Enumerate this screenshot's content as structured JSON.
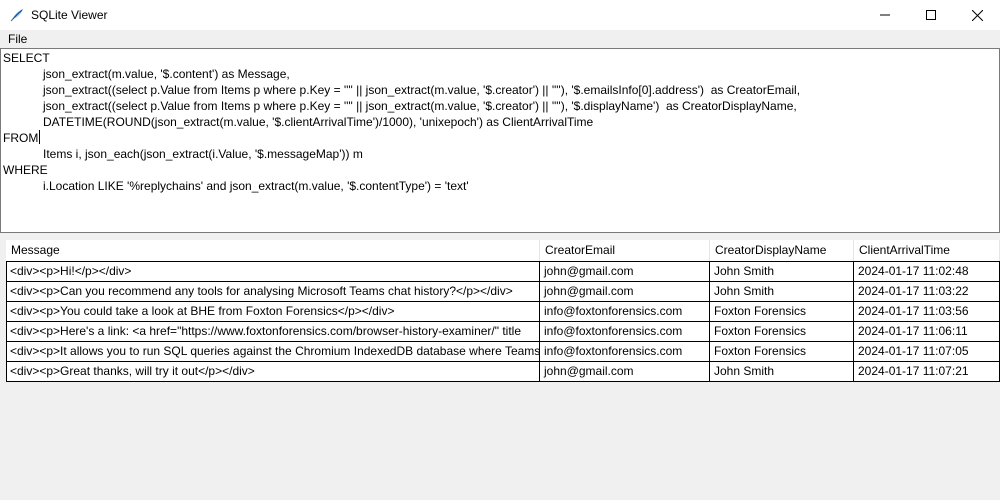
{
  "window": {
    "title": "SQLite Viewer",
    "icon": "sqlite-feather-icon"
  },
  "menu": {
    "items": [
      "File"
    ]
  },
  "editor": {
    "lines": [
      "SELECT",
      "            json_extract(m.value, '$.content') as Message,",
      "            json_extract((select p.Value from Items p where p.Key = '\"' || json_extract(m.value, '$.creator') || '\"'), '$.emailsInfo[0].address')  as CreatorEmail,",
      "            json_extract((select p.Value from Items p where p.Key = '\"' || json_extract(m.value, '$.creator') || '\"'), '$.displayName')  as CreatorDisplayName,",
      "            DATETIME(ROUND(json_extract(m.value, '$.clientArrivalTime')/1000), 'unixepoch') as ClientArrivalTime",
      "FROM",
      "            Items i, json_each(json_extract(i.Value, '$.messageMap')) m",
      "WHERE",
      "            i.Location LIKE '%replychains' and json_extract(m.value, '$.contentType') = 'text'"
    ]
  },
  "grid": {
    "columns": [
      "Message",
      "CreatorEmail",
      "CreatorDisplayName",
      "ClientArrivalTime"
    ],
    "rows": [
      [
        "<div><p>Hi!</p></div>",
        "john@gmail.com",
        "John Smith",
        "2024-01-17 11:02:48"
      ],
      [
        "<div><p>Can you recommend any tools for analysing Microsoft Teams chat history?</p></div>",
        "john@gmail.com",
        "John Smith",
        "2024-01-17 11:03:22"
      ],
      [
        "<div><p>You could take a look at BHE from Foxton Forensics</p></div>",
        "info@foxtonforensics.com",
        "Foxton Forensics",
        "2024-01-17 11:03:56"
      ],
      [
        "<div><p>Here's a link: <a href=\"https://www.foxtonforensics.com/browser-history-examiner/\" title",
        "info@foxtonforensics.com",
        "Foxton Forensics",
        "2024-01-17 11:06:11"
      ],
      [
        "<div><p>It allows you to run SQL queries against the Chromium IndexedDB database where Teams",
        "info@foxtonforensics.com",
        "Foxton Forensics",
        "2024-01-17 11:07:05"
      ],
      [
        "<div><p>Great thanks, will try it out</p></div>",
        "john@gmail.com",
        "John Smith",
        "2024-01-17 11:07:21"
      ]
    ]
  }
}
